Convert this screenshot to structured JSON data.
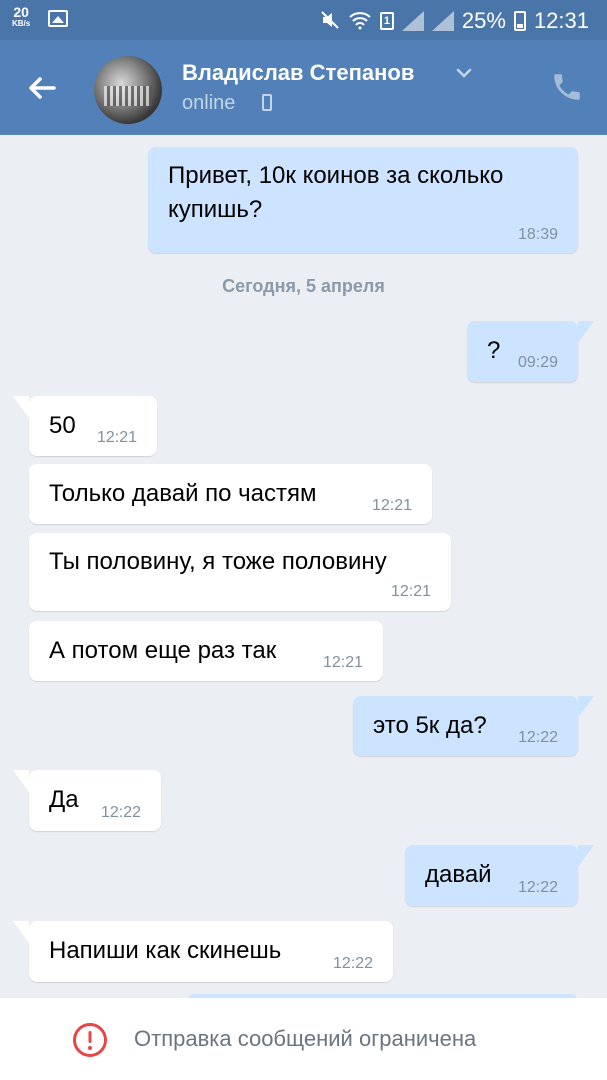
{
  "status_bar": {
    "speed_value": "20",
    "speed_unit": "KB/s",
    "sim_label": "1",
    "battery": "25%",
    "time": "12:31"
  },
  "header": {
    "contact_name": "Владислав Степанов",
    "status": "online"
  },
  "chat": {
    "date_separator": "Сегодня, 5 апреля",
    "messages": [
      {
        "side": "out",
        "text": "Привет, 10к коинов за сколько купишь?",
        "time": "18:39"
      },
      {
        "side": "out",
        "text": "?",
        "time": "09:29"
      },
      {
        "side": "in",
        "text": "50",
        "time": "12:21"
      },
      {
        "side": "in",
        "text": "Только давай по частям",
        "time": "12:21"
      },
      {
        "side": "in",
        "text": "Ты половину, я тоже половину",
        "time": "12:21"
      },
      {
        "side": "in",
        "text": "А потом еще раз так",
        "time": "12:21"
      },
      {
        "side": "out",
        "text": "это 5к да?",
        "time": "12:22"
      },
      {
        "side": "in",
        "text": "Да",
        "time": "12:22"
      },
      {
        "side": "out",
        "text": "давай",
        "time": "12:22"
      },
      {
        "side": "in",
        "text": "Напиши как скинешь",
        "time": "12:22"
      }
    ]
  },
  "footer": {
    "notice": "Отправка сообщений ограничена"
  },
  "colors": {
    "header_bg": "#5181b8",
    "chat_bg": "#ebeff3",
    "incoming_bubble": "#ffffff",
    "outgoing_bubble": "#cce4ff",
    "warning_red": "#e64646"
  }
}
